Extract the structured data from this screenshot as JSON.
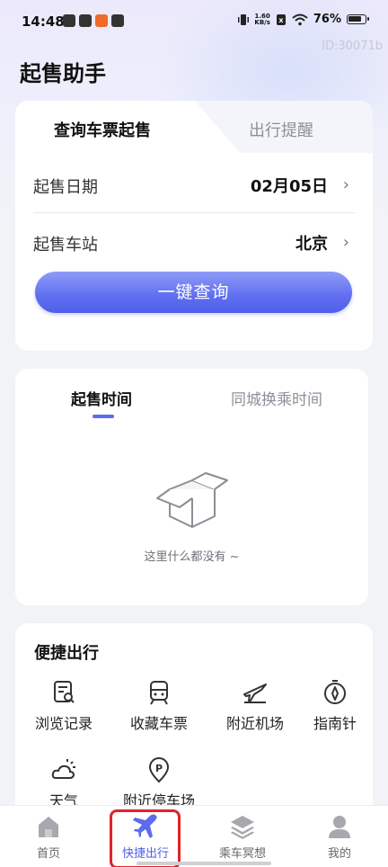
{
  "status_bar": {
    "time": "14:48",
    "network_speed": "1.60\nKB/s",
    "battery": "76%"
  },
  "id_tag": "ID:30071b",
  "page_title": "起售助手",
  "query_card": {
    "tabs": [
      "查询车票起售",
      "出行提醒"
    ],
    "date_label": "起售日期",
    "date_value": "02月05日",
    "station_label": "起售车站",
    "station_value": "北京",
    "chevron": "›",
    "query_button": "一键查询"
  },
  "time_card": {
    "tabs": [
      "起售时间",
      "同城换乘时间"
    ],
    "empty_text": "这里什么都没有 ~"
  },
  "quick_travel": {
    "title": "便捷出行",
    "items": [
      {
        "label": "浏览记录",
        "icon": "history-icon"
      },
      {
        "label": "收藏车票",
        "icon": "train-icon"
      },
      {
        "label": "附近机场",
        "icon": "plane-icon"
      },
      {
        "label": "指南针",
        "icon": "compass-icon"
      },
      {
        "label": "天气",
        "icon": "weather-icon"
      },
      {
        "label": "附近停车场",
        "icon": "parking-icon"
      }
    ]
  },
  "bottom_nav": {
    "items": [
      {
        "label": "首页",
        "icon": "home-icon"
      },
      {
        "label": "快捷出行",
        "icon": "plane-icon"
      },
      {
        "label": "乘车冥想",
        "icon": "layers-icon"
      },
      {
        "label": "我的",
        "icon": "user-icon"
      }
    ],
    "active_index": 1
  },
  "colors": {
    "accent": "#5b6cf0",
    "highlight": "#e0242b"
  }
}
